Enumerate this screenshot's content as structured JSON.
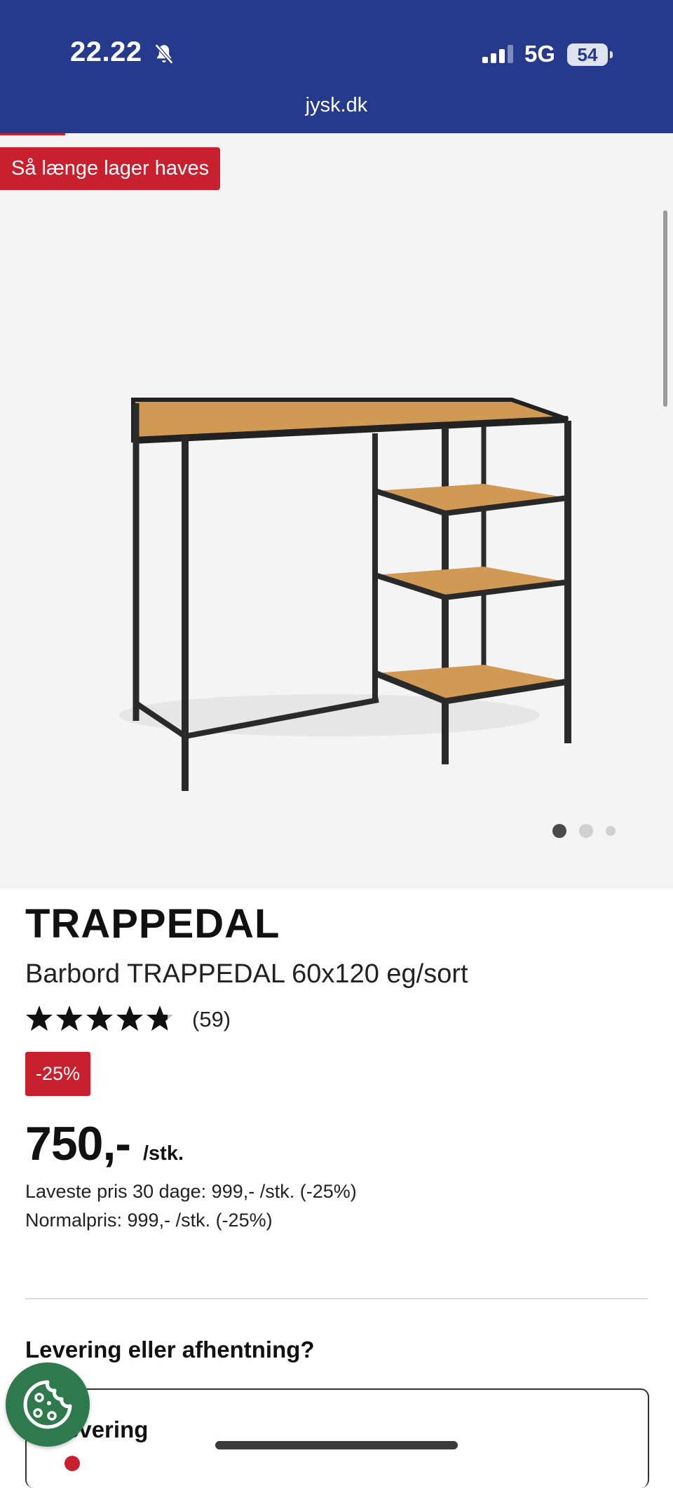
{
  "status_bar": {
    "time": "22.22",
    "network": "5G",
    "battery": "54"
  },
  "browser": {
    "url": "jysk.dk"
  },
  "gallery": {
    "stock_badge": "Så længe lager haves",
    "image_count": 3,
    "active_image": 1
  },
  "product": {
    "brand": "TRAPPEDAL",
    "name": "Barbord TRAPPEDAL 60x120 eg/sort",
    "rating_stars": 4.9,
    "rating_count": "(59)",
    "discount_badge": "-25%",
    "price": "750,-",
    "price_unit": "/stk.",
    "lowest_price_30_days": "Laveste pris 30 dage: 999,- /stk. (-25%)",
    "normal_price": "Normalpris: 999,- /stk. (-25%)"
  },
  "delivery": {
    "title": "Levering eller afhentning?",
    "option_label": "evering"
  },
  "colors": {
    "header_blue": "#253a8c",
    "sale_red": "#c8202f",
    "cookie_green": "#2f7a4c"
  },
  "icons": [
    "bell-muted-icon",
    "signal-icon",
    "battery-icon",
    "star-icon",
    "cookie-icon"
  ]
}
